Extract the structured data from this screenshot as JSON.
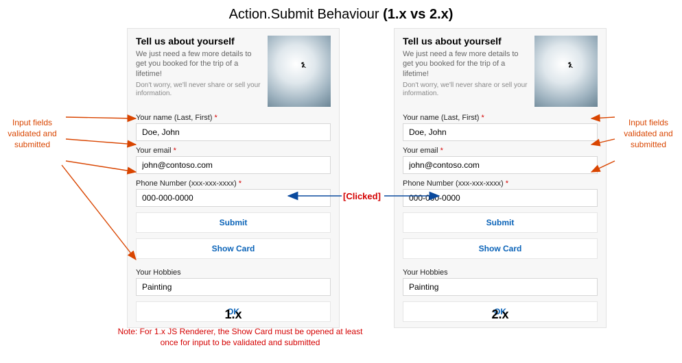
{
  "title": {
    "prefix": "Action.Submit Behaviour ",
    "suffix": "(1.x vs 2.x)"
  },
  "card": {
    "title": "Tell us about yourself",
    "subtitle": "We just need a few more details to get you booked for the trip of a lifetime!",
    "fineprint": "Don't worry, we'll never share or sell your information.",
    "fields": {
      "name": {
        "label": "Your name (Last, First)",
        "required": "*",
        "value": "Doe, John"
      },
      "email": {
        "label": "Your email",
        "required": "*",
        "value": "john@contoso.com"
      },
      "phone": {
        "label": "Phone Number (xxx-xxx-xxxx)",
        "required": "*",
        "value": "000-000-0000"
      },
      "hobby": {
        "label": "Your Hobbies",
        "value": "Painting"
      }
    },
    "buttons": {
      "submit": "Submit",
      "showcard": "Show Card",
      "ok": "OK"
    }
  },
  "versions": {
    "left": "1.x",
    "right": "2.x"
  },
  "annotations": {
    "side": "Input fields validated and submitted",
    "clicked": "[Clicked]",
    "footnote": "Note: For 1.x JS Renderer, the Show Card must be opened at least once for input to be validated and submitted"
  }
}
